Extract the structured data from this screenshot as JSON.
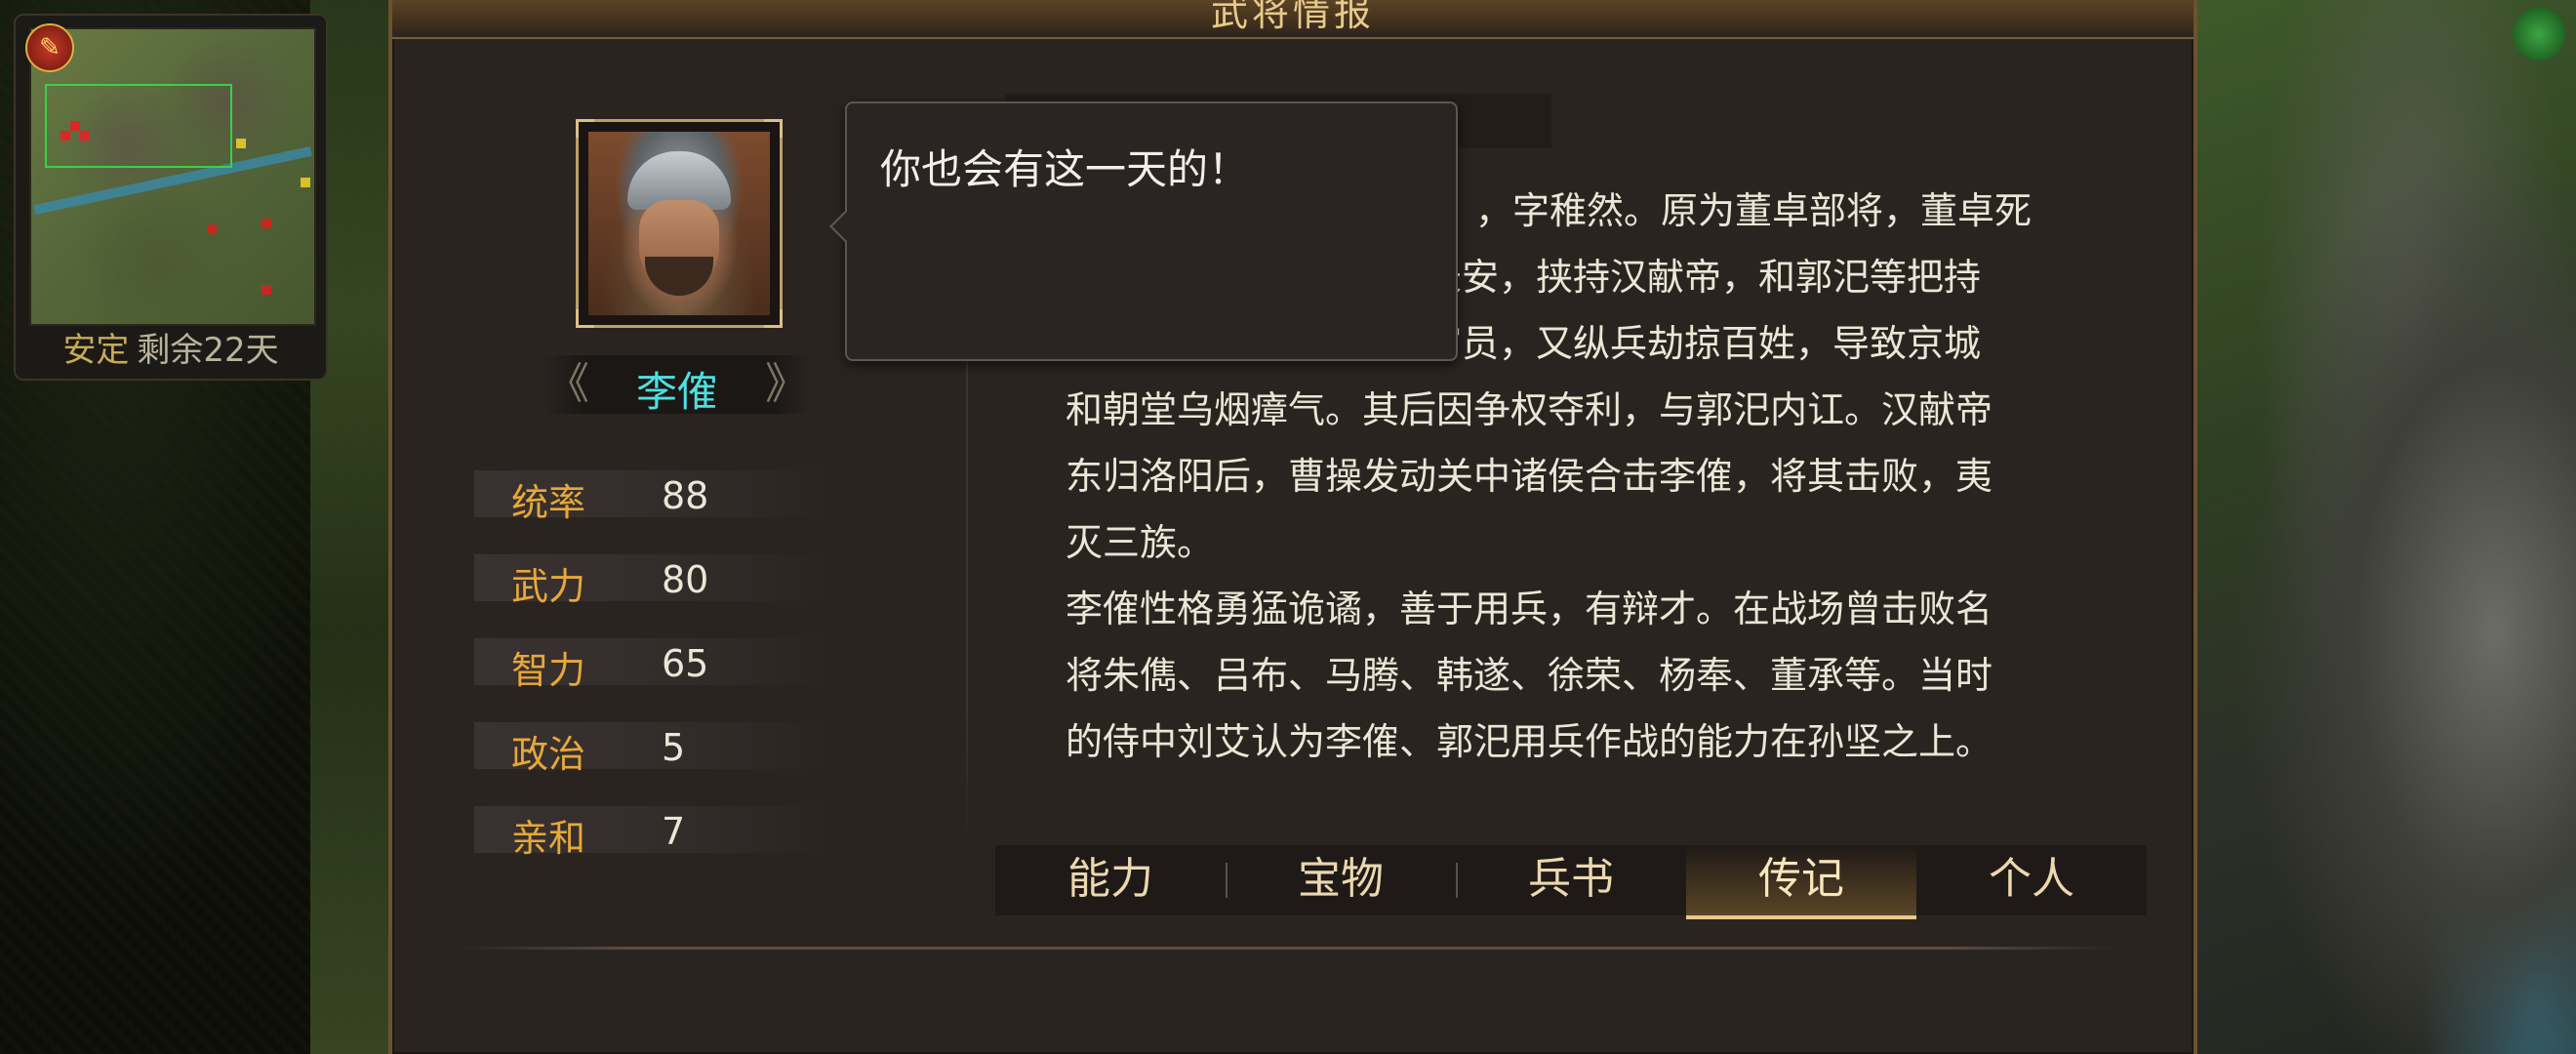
{
  "minimap": {
    "status_label": "安定",
    "status_value": "剩余22天"
  },
  "dialog": {
    "title": "武将情报"
  },
  "general": {
    "name": "李傕",
    "stats": [
      {
        "label": "统率",
        "value": "88"
      },
      {
        "label": "武力",
        "value": "80"
      },
      {
        "label": "智力",
        "value": "65"
      },
      {
        "label": "政治",
        "value": "5"
      },
      {
        "label": "亲和",
        "value": "7"
      }
    ]
  },
  "speech": {
    "text": "你也会有这一天的！"
  },
  "biography": {
    "lines": [
      "，字稚然。原为董卓部将，董卓死",
      "攻长安，挟持汉献帝，和郭汜等把持",
      "朝官员，又纵兵劫掠百姓，导致京城",
      "和朝堂乌烟瘴气。其后因争权夺利，与郭汜内讧。汉献帝",
      "东归洛阳后，曹操发动关中诸侯合击李傕，将其击败，夷",
      "灭三族。",
      "李傕性格勇猛诡谲，善于用兵，有辩才。在战场曾击败名",
      "将朱儁、吕布、马腾、韩遂、徐荣、杨奉、董承等。当时",
      "的侍中刘艾认为李傕、郭汜用兵作战的能力在孙坚之上。"
    ]
  },
  "tabs": [
    {
      "label": "能力"
    },
    {
      "label": "宝物"
    },
    {
      "label": "兵书"
    },
    {
      "label": "传记",
      "active": true
    },
    {
      "label": "个人"
    }
  ],
  "colors": {
    "stat_label": "#e7a83a",
    "name": "#4ee0e0",
    "text": "#ece6d6",
    "panel": "#2a2421"
  }
}
